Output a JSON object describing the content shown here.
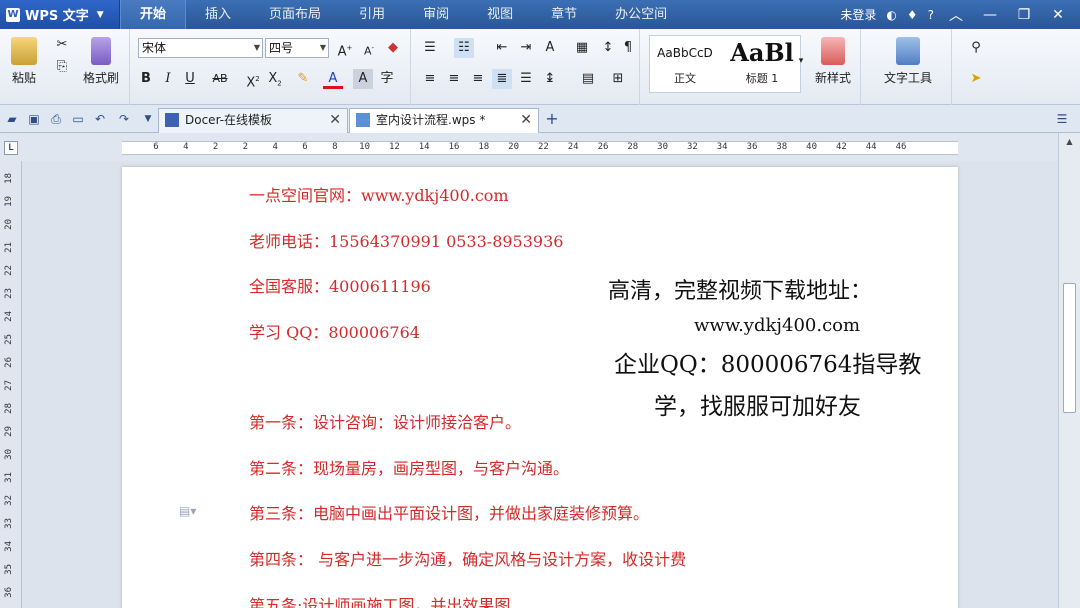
{
  "app": {
    "name": "WPS 文字"
  },
  "menu": {
    "tabs": [
      "开始",
      "插入",
      "页面布局",
      "引用",
      "审阅",
      "视图",
      "章节",
      "办公空间"
    ],
    "login": "未登录",
    "help": "?"
  },
  "ribbon": {
    "paste": "粘贴",
    "format_painter": "格式刷",
    "font_name": "宋体",
    "font_size": "四号",
    "styles": [
      {
        "sample": "AaBbCcD⁠",
        "label": "正文"
      },
      {
        "sample": "AaBl",
        "label": "标题 1"
      }
    ],
    "new_style": "新样式",
    "text_tools": "文字工具"
  },
  "tabs": [
    {
      "label": "Docer-在线模板"
    },
    {
      "label": "室内设计流程.wps *"
    }
  ],
  "ruler": {
    "h_ticks": [
      "6",
      "4",
      "2",
      "2",
      "4",
      "6",
      "8",
      "10",
      "12",
      "14",
      "16",
      "18",
      "20",
      "22",
      "24",
      "26",
      "28",
      "30",
      "32",
      "34",
      "36",
      "38",
      "40",
      "42",
      "44",
      "46"
    ],
    "v_ticks": [
      "18",
      "19",
      "20",
      "21",
      "22",
      "23",
      "24",
      "25",
      "26",
      "27",
      "28",
      "29",
      "30",
      "31",
      "32",
      "33",
      "34",
      "35",
      "36"
    ]
  },
  "document": {
    "lines": [
      "一点空间官网：www.ydkj400.com",
      "老师电话：15564370991    0533-8953936",
      "全国客服：4000611196",
      "学习 QQ：800006764",
      "第一条：设计咨询：设计师接洽客户。",
      "第二条：现场量房，画房型图，与客户沟通。",
      "第三条：电脑中画出平面设计图，并做出家庭装修预算。",
      "第四条：   与客户进一步沟通，确定风格与设计方案，收设计费",
      "第五条:设计师画施工图，并出效果图"
    ],
    "overlay": {
      "line1": "高清，完整视频下载地址：",
      "line2": "www.ydkj400.com",
      "line3": "企业QQ：800006764指导教",
      "line4": "学，找服服可加好友"
    }
  },
  "colors": {
    "text_red": "#d42a2a",
    "menubar": "#2a5694"
  }
}
